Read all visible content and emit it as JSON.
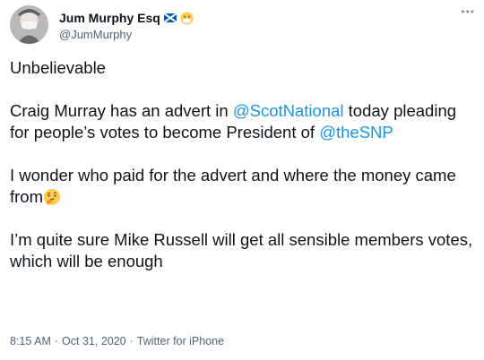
{
  "author": {
    "display_name": "Jum Murphy Esq",
    "handle": "@JumMurphy"
  },
  "tweet": {
    "line1": "Unbelievable",
    "p2_part1": "Craig Murray has an advert in ",
    "p2_mention1": "@ScotNational",
    "p2_part2": " today pleading for people’s votes to become President of ",
    "p2_mention2": "@theSNP",
    "p3": "I wonder who paid for the advert and where the money came from",
    "p4": "I’m quite sure Mike Russell will get all sensible members votes, which will be enough"
  },
  "meta": {
    "time": "8:15 AM",
    "sep": "·",
    "date": "Oct 31, 2020",
    "sep2": "·",
    "source": "Twitter for iPhone"
  },
  "colors": {
    "mention": "#1b95e0",
    "meta": "#536471"
  },
  "icons": {
    "flag": "scotland-flag-icon",
    "mask": "face-mask-emoji-icon",
    "think": "thinking-face-emoji-icon",
    "more": "more-options-icon"
  }
}
